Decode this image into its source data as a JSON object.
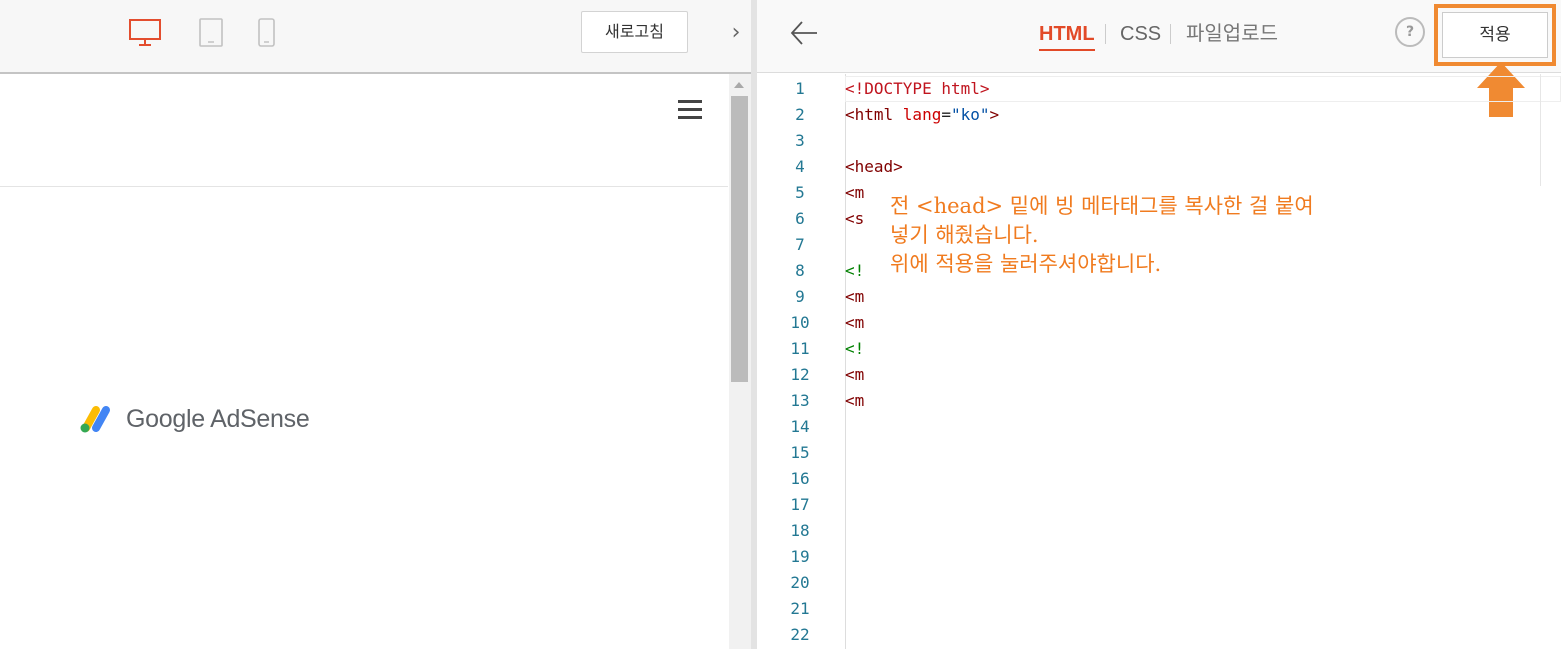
{
  "preview_toolbar": {
    "devices": [
      {
        "name": "desktop-icon",
        "selected": true
      },
      {
        "name": "tablet-icon",
        "selected": false
      },
      {
        "name": "mobile-icon",
        "selected": false
      }
    ],
    "refresh_label": "새로고침",
    "collapse_icon": "chevron-right-icon"
  },
  "preview": {
    "menu_icon": "hamburger-icon",
    "logo_text": "Google AdSense"
  },
  "editor_toolbar": {
    "back_icon": "arrow-left-icon",
    "tabs": [
      {
        "label": "HTML",
        "active": true
      },
      {
        "label": "CSS",
        "active": false
      },
      {
        "label": "파일업로드",
        "active": false
      }
    ],
    "help_label": "?",
    "apply_label": "적용",
    "highlight_color": "#f08a32",
    "active_tab_color": "#e24a28"
  },
  "editor": {
    "line_numbers": [
      "1",
      "2",
      "3",
      "4",
      "5",
      "6",
      "7",
      "8",
      "9",
      "10",
      "11",
      "12",
      "13",
      "14",
      "15",
      "16",
      "17",
      "18",
      "19",
      "20",
      "21",
      "22"
    ],
    "lines": [
      {
        "parts": [
          {
            "t": "<!DOCTYPE html>",
            "c": "doctype"
          }
        ]
      },
      {
        "parts": [
          {
            "t": "<html ",
            "c": "tag"
          },
          {
            "t": "lang",
            "c": "attr"
          },
          {
            "t": "=",
            "c": ""
          },
          {
            "t": "\"ko\"",
            "c": "val"
          },
          {
            "t": ">",
            "c": "tag"
          }
        ]
      },
      {
        "parts": []
      },
      {
        "parts": [
          {
            "t": "<head>",
            "c": "tag"
          }
        ]
      },
      {
        "parts": [
          {
            "t": "<m",
            "c": "tag"
          }
        ]
      },
      {
        "parts": [
          {
            "t": "<s",
            "c": "tag"
          }
        ]
      },
      {
        "parts": []
      },
      {
        "parts": [
          {
            "t": "<!",
            "c": "cmt"
          }
        ]
      },
      {
        "parts": [
          {
            "t": "<m",
            "c": "tag"
          }
        ]
      },
      {
        "parts": [
          {
            "t": "<m",
            "c": "tag"
          }
        ]
      },
      {
        "parts": [
          {
            "t": "<!",
            "c": "cmt"
          }
        ]
      },
      {
        "parts": [
          {
            "t": "<m",
            "c": "tag"
          }
        ]
      },
      {
        "parts": [
          {
            "t": "<m",
            "c": "tag"
          }
        ]
      }
    ]
  },
  "annotation": {
    "text": "전 <head> 밑에 빙 메타태그를 복사한 걸 붙여\n넣기 해줬습니다.\n위에 적용을 눌러주셔야합니다.",
    "color": "#f07b1f"
  }
}
